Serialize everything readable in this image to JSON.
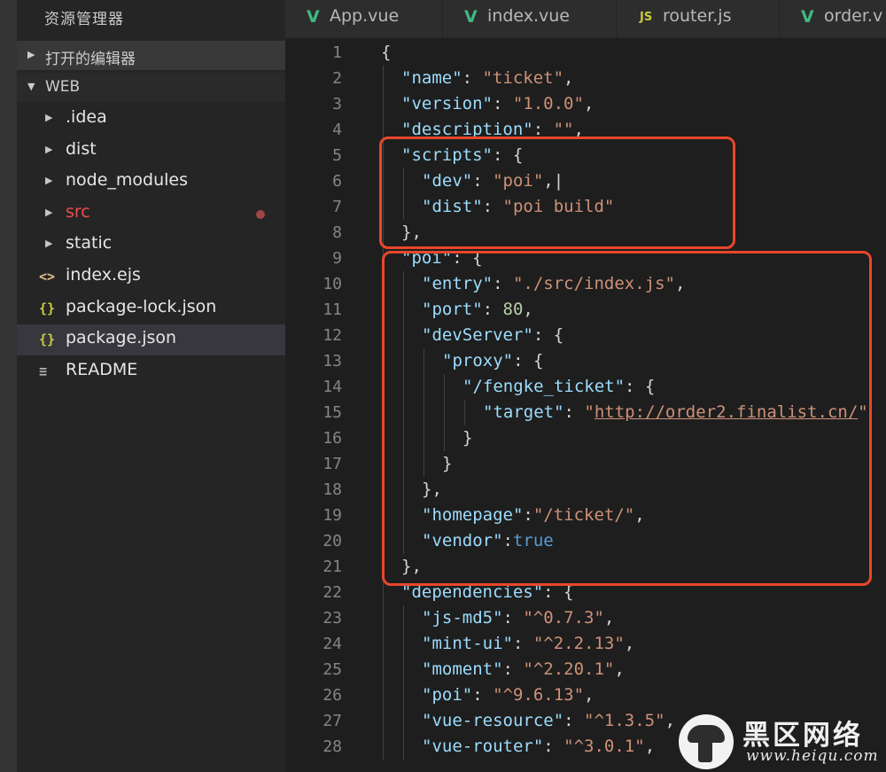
{
  "explorer": {
    "title": "资源管理器",
    "open_editors_label": "打开的编辑器",
    "folder_label": "WEB",
    "items": [
      {
        "name": ".idea",
        "type": "folder",
        "icon": "chevron-right-icon"
      },
      {
        "name": "dist",
        "type": "folder",
        "icon": "chevron-right-icon"
      },
      {
        "name": "node_modules",
        "type": "folder",
        "icon": "chevron-right-icon"
      },
      {
        "name": "src",
        "type": "folder",
        "icon": "chevron-right-icon",
        "modified": true,
        "color": "#f14c4c"
      },
      {
        "name": "static",
        "type": "folder",
        "icon": "chevron-right-icon"
      },
      {
        "name": "index.ejs",
        "type": "file",
        "icon": "html-file-icon",
        "glyph": "<>",
        "icon_color": "#e2c08d"
      },
      {
        "name": "package-lock.json",
        "type": "file",
        "icon": "json-file-icon",
        "glyph": "{}",
        "icon_color": "#cbcb41"
      },
      {
        "name": "package.json",
        "type": "file",
        "icon": "json-file-icon",
        "glyph": "{}",
        "icon_color": "#cbcb41",
        "selected": true
      },
      {
        "name": "README",
        "type": "file",
        "icon": "text-file-icon",
        "glyph": "≡",
        "icon_color": "#b0b0b0"
      }
    ]
  },
  "tabs": [
    {
      "label": "App.vue",
      "icon": "vue-icon",
      "glyph": "V",
      "icon_color": "#41b883"
    },
    {
      "label": "index.vue",
      "icon": "vue-icon",
      "glyph": "V",
      "icon_color": "#41b883"
    },
    {
      "label": "router.js",
      "icon": "js-icon",
      "glyph": "JS",
      "icon_color": "#cbcb41"
    },
    {
      "label": "order.v",
      "icon": "vue-icon",
      "glyph": "V",
      "icon_color": "#41b883"
    }
  ],
  "editor": {
    "lines": [
      {
        "n": "1",
        "indent": 0,
        "tokens": [
          [
            "p",
            "{"
          ]
        ]
      },
      {
        "n": "2",
        "indent": 1,
        "tokens": [
          [
            "k",
            "\"name\""
          ],
          [
            "p",
            ": "
          ],
          [
            "s",
            "\"ticket\""
          ],
          [
            "p",
            ","
          ]
        ]
      },
      {
        "n": "3",
        "indent": 1,
        "tokens": [
          [
            "k",
            "\"version\""
          ],
          [
            "p",
            ": "
          ],
          [
            "s",
            "\"1.0.0\""
          ],
          [
            "p",
            ","
          ]
        ]
      },
      {
        "n": "4",
        "indent": 1,
        "tokens": [
          [
            "k",
            "\"description\""
          ],
          [
            "p",
            ": "
          ],
          [
            "s",
            "\"\""
          ],
          [
            "p",
            ","
          ]
        ]
      },
      {
        "n": "5",
        "indent": 1,
        "tokens": [
          [
            "k",
            "\"scripts\""
          ],
          [
            "p",
            ": {"
          ]
        ]
      },
      {
        "n": "6",
        "indent": 2,
        "tokens": [
          [
            "k",
            "\"dev\""
          ],
          [
            "p",
            ": "
          ],
          [
            "s",
            "\"poi\""
          ],
          [
            "p",
            ",|"
          ]
        ]
      },
      {
        "n": "7",
        "indent": 2,
        "tokens": [
          [
            "k",
            "\"dist\""
          ],
          [
            "p",
            ": "
          ],
          [
            "s",
            "\"poi build\""
          ]
        ]
      },
      {
        "n": "8",
        "indent": 1,
        "tokens": [
          [
            "p",
            "},"
          ]
        ]
      },
      {
        "n": "9",
        "indent": 1,
        "tokens": [
          [
            "k",
            "\"poi\""
          ],
          [
            "p",
            ": {"
          ]
        ]
      },
      {
        "n": "10",
        "indent": 2,
        "tokens": [
          [
            "k",
            "\"entry\""
          ],
          [
            "p",
            ": "
          ],
          [
            "s",
            "\"./src/index.js\""
          ],
          [
            "p",
            ","
          ]
        ]
      },
      {
        "n": "11",
        "indent": 2,
        "tokens": [
          [
            "k",
            "\"port\""
          ],
          [
            "p",
            ": "
          ],
          [
            "n",
            "80"
          ],
          [
            "p",
            ","
          ]
        ]
      },
      {
        "n": "12",
        "indent": 2,
        "tokens": [
          [
            "k",
            "\"devServer\""
          ],
          [
            "p",
            ": {"
          ]
        ]
      },
      {
        "n": "13",
        "indent": 3,
        "tokens": [
          [
            "k",
            "\"proxy\""
          ],
          [
            "p",
            ": {"
          ]
        ]
      },
      {
        "n": "14",
        "indent": 4,
        "tokens": [
          [
            "k",
            "\"/fengke_ticket\""
          ],
          [
            "p",
            ": {"
          ]
        ]
      },
      {
        "n": "15",
        "indent": 5,
        "tokens": [
          [
            "k",
            "\"target\""
          ],
          [
            "p",
            ": "
          ],
          [
            "s",
            "\""
          ],
          [
            "u",
            "http://order2.finalist.cn/"
          ],
          [
            "s",
            "\""
          ]
        ]
      },
      {
        "n": "16",
        "indent": 4,
        "tokens": [
          [
            "p",
            "}"
          ]
        ]
      },
      {
        "n": "17",
        "indent": 3,
        "tokens": [
          [
            "p",
            "}"
          ]
        ]
      },
      {
        "n": "18",
        "indent": 2,
        "tokens": [
          [
            "p",
            "},"
          ]
        ]
      },
      {
        "n": "19",
        "indent": 2,
        "tokens": [
          [
            "k",
            "\"homepage\""
          ],
          [
            "p",
            ":"
          ],
          [
            "s",
            "\"/ticket/\""
          ],
          [
            "p",
            ","
          ]
        ]
      },
      {
        "n": "20",
        "indent": 2,
        "tokens": [
          [
            "k",
            "\"vendor\""
          ],
          [
            "p",
            ":"
          ],
          [
            "b",
            "true"
          ]
        ]
      },
      {
        "n": "21",
        "indent": 1,
        "tokens": [
          [
            "p",
            "},"
          ]
        ]
      },
      {
        "n": "22",
        "indent": 1,
        "tokens": [
          [
            "k",
            "\"dependencies\""
          ],
          [
            "p",
            ": {"
          ]
        ]
      },
      {
        "n": "23",
        "indent": 2,
        "tokens": [
          [
            "k",
            "\"js-md5\""
          ],
          [
            "p",
            ": "
          ],
          [
            "s",
            "\"^0.7.3\""
          ],
          [
            "p",
            ","
          ]
        ]
      },
      {
        "n": "24",
        "indent": 2,
        "tokens": [
          [
            "k",
            "\"mint-ui\""
          ],
          [
            "p",
            ": "
          ],
          [
            "s",
            "\"^2.2.13\""
          ],
          [
            "p",
            ","
          ]
        ]
      },
      {
        "n": "25",
        "indent": 2,
        "tokens": [
          [
            "k",
            "\"moment\""
          ],
          [
            "p",
            ": "
          ],
          [
            "s",
            "\"^2.20.1\""
          ],
          [
            "p",
            ","
          ]
        ]
      },
      {
        "n": "26",
        "indent": 2,
        "tokens": [
          [
            "k",
            "\"poi\""
          ],
          [
            "p",
            ": "
          ],
          [
            "s",
            "\"^9.6.13\""
          ],
          [
            "p",
            ","
          ]
        ]
      },
      {
        "n": "27",
        "indent": 2,
        "tokens": [
          [
            "k",
            "\"vue-resource\""
          ],
          [
            "p",
            ": "
          ],
          [
            "s",
            "\"^1.3.5\""
          ],
          [
            "p",
            ","
          ]
        ]
      },
      {
        "n": "28",
        "indent": 2,
        "tokens": [
          [
            "k",
            "\"vue-router\""
          ],
          [
            "p",
            ": "
          ],
          [
            "s",
            "\"^3.0.1\""
          ],
          [
            "p",
            ","
          ]
        ]
      }
    ],
    "colors": {
      "key": "#9cdcfe",
      "string": "#ce9178",
      "number": "#b5cea8",
      "boolean": "#569cd6",
      "annotation": "#e8472b"
    }
  },
  "watermark": {
    "title": "黑区网络",
    "url": "www.heiqu.com"
  }
}
